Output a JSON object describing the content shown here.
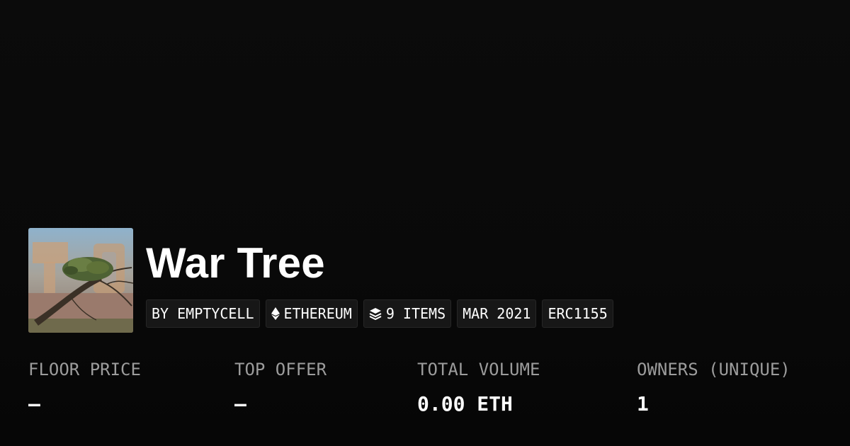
{
  "collection": {
    "title": "War Tree",
    "thumbnail_icon": "tree-artwork-thumbnail"
  },
  "badges": [
    {
      "label": "BY EMPTYCELL",
      "icon": null
    },
    {
      "label": "ETHEREUM",
      "icon": "ethereum-icon"
    },
    {
      "label": "9 ITEMS",
      "icon": "layers-icon"
    },
    {
      "label": "MAR 2021",
      "icon": null
    },
    {
      "label": "ERC1155",
      "icon": null
    }
  ],
  "stats": [
    {
      "label": "FLOOR PRICE",
      "value": "–"
    },
    {
      "label": "TOP OFFER",
      "value": "–"
    },
    {
      "label": "TOTAL VOLUME",
      "value": "0.00 ETH"
    },
    {
      "label": "OWNERS (UNIQUE)",
      "value": "1"
    }
  ],
  "colors": {
    "background": "#0a0a0a",
    "badge_bg": "#171717",
    "label_gray": "#9c9c9c",
    "text": "#ffffff"
  }
}
